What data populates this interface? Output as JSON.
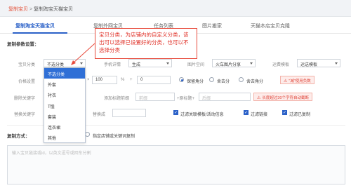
{
  "breadcrumb": {
    "parent": "复制宝贝",
    "sep": ">",
    "current": "复制淘宝天猫宝贝"
  },
  "tabs": [
    {
      "label": "复制淘宝天猫宝贝"
    },
    {
      "label": "复制外网宝贝"
    },
    {
      "label": "任务列表"
    },
    {
      "label": "图片搬家"
    },
    {
      "label": "天猫本店宝贝克隆"
    }
  ],
  "params": {
    "section_title": "复制参数设置：",
    "category": {
      "label": "宝贝分类",
      "value": "不选分类"
    },
    "mobile_detail": {
      "label": "手机详情",
      "value": "生成"
    },
    "image_space": {
      "label": "图片空间",
      "value": "火车图片分享"
    },
    "freight": {
      "label": "运费模板",
      "value": "运送模板"
    },
    "price": {
      "label": "价格设置",
      "op": "×",
      "multiplier": "100",
      "unit": "%",
      "plus": "+",
      "add": "0"
    },
    "rounding": [
      {
        "label": "保留角分"
      },
      {
        "label": "舍去分"
      },
      {
        "label": "舍去角分"
      }
    ],
    "rounding_warning": "\"减\"使用负数",
    "delete_kw": {
      "label": "删除关键字",
      "placeholder": "多个关键字"
    },
    "title_add": {
      "label": "添加标题前缀",
      "placeholder": "前缀"
    },
    "title_suffix": {
      "label": "+原标题+",
      "placeholder": "后缀"
    },
    "title_warning": "长度超过30个字符自动截断",
    "replace_kw": {
      "label": "替换关键字",
      "replace_label": "替换成"
    },
    "filters": [
      {
        "label": "过滤关联模板/活动信息"
      },
      {
        "label": "过滤链接"
      },
      {
        "label": "过滤已复制"
      }
    ]
  },
  "dropdown": {
    "options": [
      {
        "label": "不选分类",
        "selected": true
      },
      {
        "label": "外套"
      },
      {
        "label": "衬衣"
      },
      {
        "label": "T恤"
      },
      {
        "label": "套装"
      },
      {
        "label": "连衣裙"
      },
      {
        "label": "其他"
      }
    ]
  },
  "callout": {
    "text": "宝贝分类，为店铺内的自定义分类，该出可以选择已设置好的分类，也可以不选择分类"
  },
  "copy_mode": {
    "label": "复制方式：",
    "option_link": "",
    "option_store": "指定店铺或关键词复制"
  },
  "input_area": {
    "placeholder": "输入宝贝链接或id，以英文逗号或回车分割"
  },
  "colors": {
    "accent": "#2b61c8",
    "brand_red": "#e4533b",
    "callout_red": "#e0332a",
    "selected_bg": "#2f6fd6"
  }
}
